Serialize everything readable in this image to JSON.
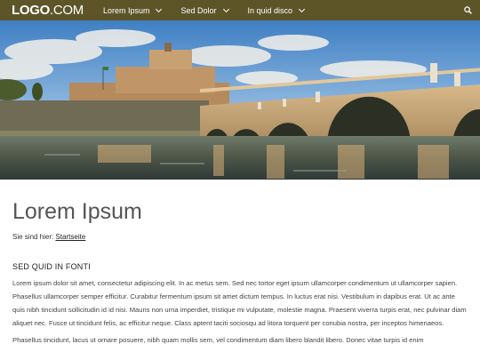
{
  "nav": {
    "logo_bold": "LOGO",
    "logo_light": ".COM",
    "items": [
      {
        "label": "Lorem Ipsum"
      },
      {
        "label": "Sed Dolor"
      },
      {
        "label": "In quid disco"
      }
    ],
    "icons": {
      "search": "search-icon",
      "chevron": "chevron-down-icon"
    }
  },
  "hero": {
    "icon": "castle-bridge-photo"
  },
  "page": {
    "title": "Lorem Ipsum",
    "breadcrumb_prefix": "Sie sind hier:",
    "breadcrumb_link": "Startseite",
    "subheading": "SED QUID IN FONTI",
    "paragraphs": [
      "Lorem ipsum dolor sit amet, consectetur adipiscing elit. In ac metus sem. Sed nec tortor eget ipsum ullamcorper condimentum ut ullamcorper sapien. Phasellus ullamcorper semper efficitur. Curabitur fermentum ipsum sit amet dictum tempus. In luctus erat nisi. Vestibulum in dapibus erat. Ut ac ante quis nibh tincidunt sollicitudin id id nisi. Mauris non urna imperdiet, tristique mi vulputate, molestie magna. Praesent viverra turpis erat, nec pulvinar diam aliquet nec. Fusce ut tincidunt felis, ac efficitur neque. Class aptent taciti sociosqu ad litora torquent per conubia nostra, per inceptos himenaeos.",
      "Phasellus tincidunt, lacus ut ornare posuere, nibh quam mollis sem, vel condimentum diam libero blandit libero. Donec vitae turpis id enim"
    ]
  },
  "colors": {
    "nav_bg": "#5d5528",
    "title": "#555555",
    "text": "#444444"
  }
}
